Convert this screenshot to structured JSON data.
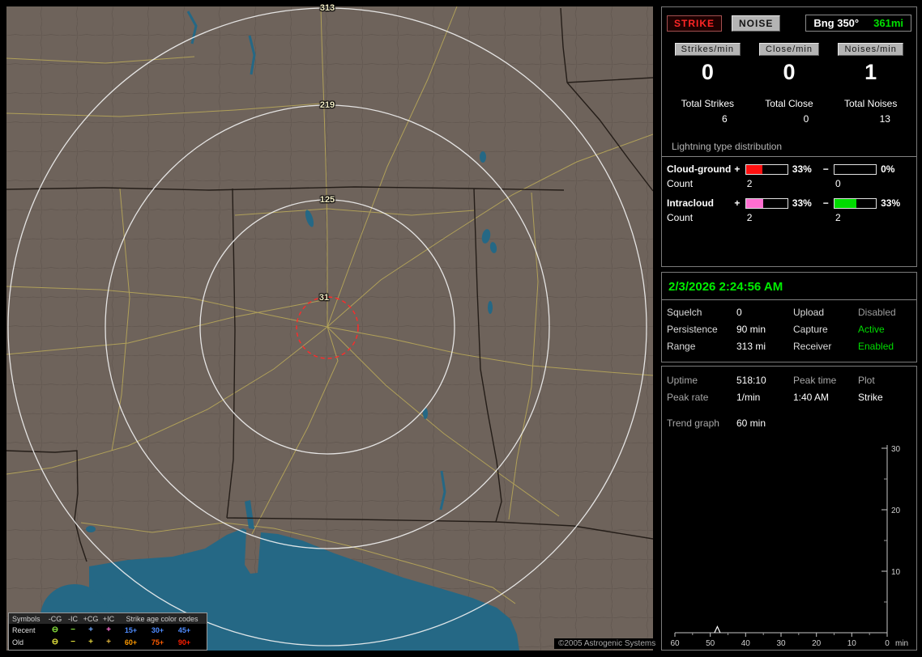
{
  "app": {
    "copyright": "©2005 Astrogenic Systems"
  },
  "map": {
    "ring_labels": [
      "313",
      "219",
      "125",
      "31"
    ],
    "legend": {
      "title_symbols": "Symbols",
      "cols": [
        "-CG",
        "-IC",
        "+CG",
        "+IC"
      ],
      "title_ages": "Strike age color codes",
      "rows": [
        {
          "label": "Recent",
          "sym": [
            "⊖",
            "−",
            "+",
            "+"
          ],
          "sym_colors": [
            "#86e03c",
            "#86e03c",
            "#6fa8ff",
            "#ff72d4"
          ],
          "ages": [
            "15+",
            "30+",
            "45+"
          ],
          "age_colors": [
            "#4f8cff",
            "#4f8cff",
            "#4f8cff"
          ]
        },
        {
          "label": "Old",
          "sym": [
            "⊖",
            "−",
            "+",
            "+"
          ],
          "sym_colors": [
            "#e0e03c",
            "#e0e03c",
            "#e0d23c",
            "#e0b43c"
          ],
          "ages": [
            "60+",
            "75+",
            "90+"
          ],
          "age_colors": [
            "#ff9a00",
            "#ff5c00",
            "#ff1e00"
          ]
        }
      ]
    }
  },
  "sidebar": {
    "buttons": {
      "strike": "STRIKE",
      "noise": "NOISE"
    },
    "bearing": {
      "label": "Bng 350°",
      "distance": "361mi"
    },
    "rates": [
      {
        "label": "Strikes/min",
        "value": "0"
      },
      {
        "label": "Close/min",
        "value": "0"
      },
      {
        "label": "Noises/min",
        "value": "1"
      }
    ],
    "totals": [
      {
        "label": "Total Strikes",
        "value": "6"
      },
      {
        "label": "Total Close",
        "value": "0"
      },
      {
        "label": "Total Noises",
        "value": "13"
      }
    ],
    "distribution": {
      "title": "Lightning type distribution",
      "plus": "+",
      "minus": "−",
      "count_label": "Count",
      "rows": [
        {
          "label": "Cloud-ground",
          "pos_pct": "33%",
          "pos_fill": 40,
          "pos_color": "#ff1010",
          "neg_pct": "0%",
          "neg_fill": 0,
          "neg_color": "#00d000",
          "pos_count": "2",
          "neg_count": "0"
        },
        {
          "label": "Intracloud",
          "pos_pct": "33%",
          "pos_fill": 42,
          "pos_color": "#ff6ed0",
          "neg_pct": "33%",
          "neg_fill": 52,
          "neg_color": "#00dc00",
          "pos_count": "2",
          "neg_count": "2"
        }
      ]
    },
    "datetime": "2/3/2026 2:24:56 AM",
    "status_rows": [
      [
        "Squelch",
        "0",
        "Upload",
        "Disabled"
      ],
      [
        "Persistence",
        "90 min",
        "Capture",
        "Active"
      ],
      [
        "Range",
        "313 mi",
        "Receiver",
        "Enabled"
      ]
    ],
    "perf_rows": [
      [
        "Uptime",
        "518:10",
        "Peak time",
        "Plot"
      ],
      [
        "Peak rate",
        "1/min",
        "1:40 AM",
        "Strike"
      ]
    ],
    "trend_label": "Trend graph",
    "trend_value": "60 min"
  },
  "chart_data": {
    "type": "line",
    "title": "Trend graph",
    "window_label": "60 min",
    "xlabel": "min",
    "x_ticks": [
      "60",
      "50",
      "40",
      "30",
      "20",
      "10",
      "0"
    ],
    "y_ticks": [
      "30",
      "20",
      "10"
    ],
    "ylim": [
      0,
      30
    ],
    "x_minutes_range": [
      60,
      0
    ],
    "series": [
      {
        "name": "Strike",
        "points": [
          [
            48.8,
            0
          ],
          [
            48,
            1
          ],
          [
            47.2,
            0
          ]
        ]
      }
    ],
    "note": "flat at 0 strikes/min except a single 1/min spike ~48 minutes ago (peak 1:40 AM)"
  }
}
